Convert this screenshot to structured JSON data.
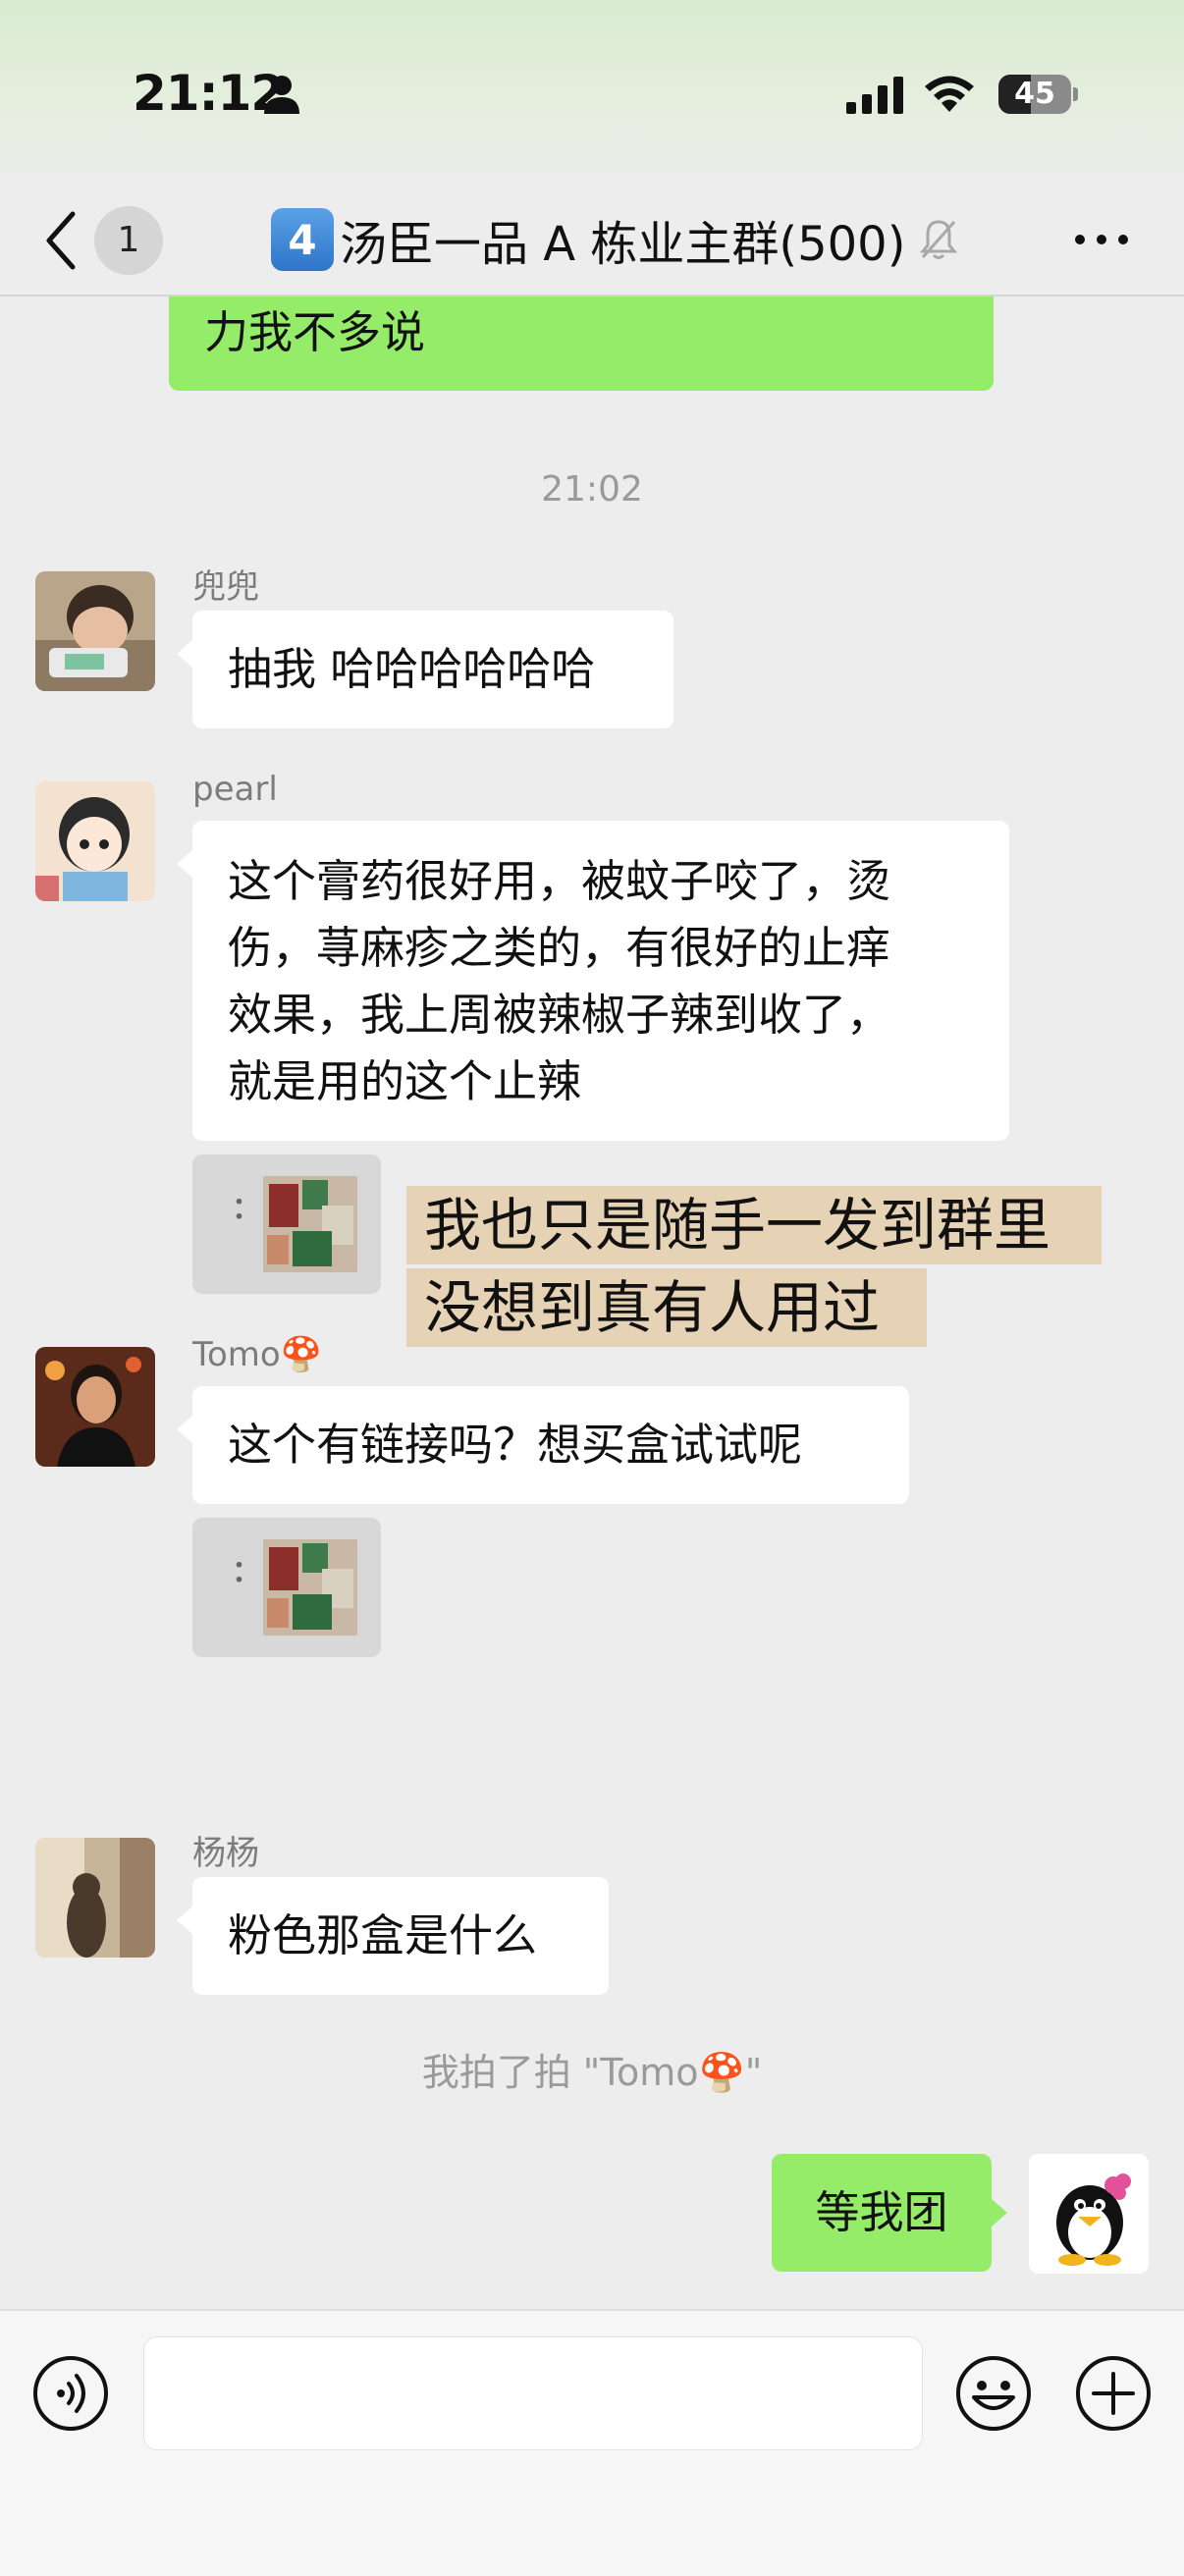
{
  "status_bar": {
    "time": "21:12",
    "battery_level": "45",
    "battery_fraction": 0.45
  },
  "nav": {
    "unread_count": "1",
    "title_number": "4",
    "title": "汤臣一品 A 栋业主群(500)"
  },
  "messages": {
    "partial_outgoing": "力我不多说",
    "time_divider": "21:02",
    "m1": {
      "sender": "兜兜",
      "text": "抽我 哈哈哈哈哈哈"
    },
    "m2": {
      "sender": "pearl",
      "lines": [
        "这个膏药很好用，被蚊子咬了，烫",
        "伤，荨麻疹之类的，有很好的止痒",
        "效果，我上周被辣椒子辣到收了，",
        "就是用的这个止辣"
      ],
      "image_dots": "："
    },
    "sticker_lines": [
      "我也只是随手一发到群里",
      "没想到真有人用过"
    ],
    "m3": {
      "sender": "Tomo🍄",
      "text": "这个有链接吗？想买盒试试呢",
      "image_dots": "："
    },
    "m4": {
      "sender": "杨杨",
      "text": "粉色那盒是什么"
    },
    "system_notice": "我拍了拍 \"Tomo🍄\"",
    "m5": {
      "text": "等我团"
    }
  },
  "colors": {
    "outgoing_bubble": "#95ec69",
    "incoming_bubble": "#ffffff",
    "chat_background": "#ededed",
    "sticker_paper": "#e6d3b5"
  },
  "icons": [
    "person-icon",
    "signal-icon",
    "wifi-icon",
    "battery-icon",
    "back-chevron-icon",
    "mute-bell-icon",
    "more-dots-icon",
    "voice-icon",
    "emoji-icon",
    "plus-icon"
  ]
}
